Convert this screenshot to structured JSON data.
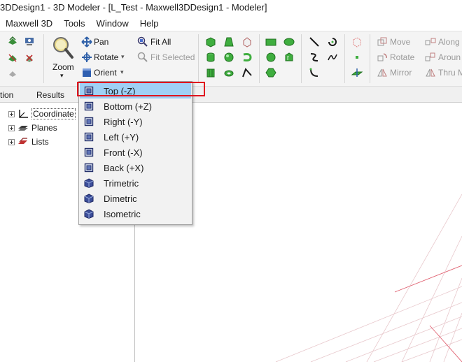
{
  "window": {
    "title": "3DDesign1 - 3D Modeler - [L_Test - Maxwell3DDesign1 - Modeler]"
  },
  "menubar": {
    "items": [
      "Maxwell 3D",
      "Tools",
      "Window",
      "Help"
    ]
  },
  "ribbon": {
    "zoom_label": "Zoom",
    "pan_label": "Pan",
    "rotate_label": "Rotate",
    "orient_label": "Orient",
    "fit_all_label": "Fit All",
    "fit_selected_label": "Fit Selected",
    "move_label": "Move",
    "rotate2_label": "Rotate",
    "mirror_label": "Mirror",
    "along_label": "Along",
    "around_label": "Aroun",
    "thru_label": "Thru M"
  },
  "tabs": {
    "left": "tion",
    "results": "Results"
  },
  "tree": {
    "items": [
      "Coordinate",
      "Planes",
      "Lists"
    ]
  },
  "orient_menu": {
    "items": [
      "Top (-Z)",
      "Bottom (+Z)",
      "Right (-Y)",
      "Left (+Y)",
      "Front (-X)",
      "Back (+X)",
      "Trimetric",
      "Dimetric",
      "Isometric"
    ],
    "selected_index": 0
  },
  "colors": {
    "selection": "#9fd0f5",
    "annotation_box": "#e0141e",
    "grid": "#e06070"
  }
}
